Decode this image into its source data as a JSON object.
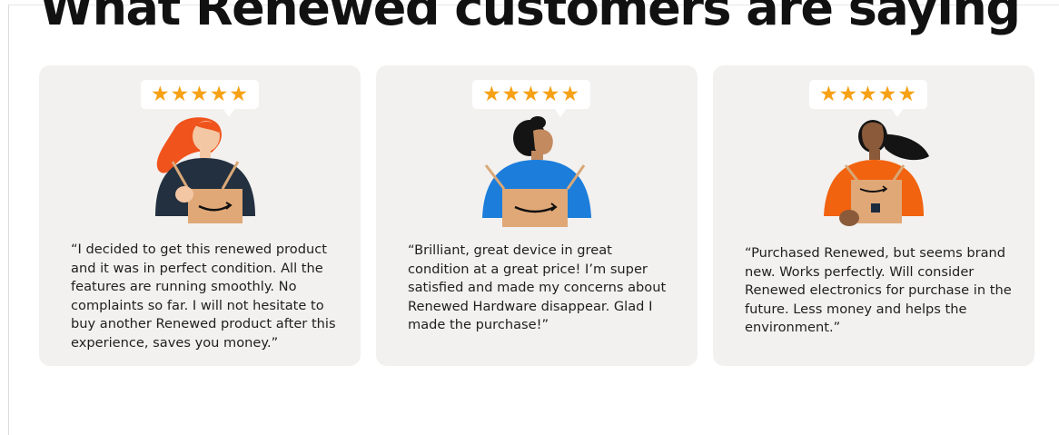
{
  "section": {
    "title": "What Renewed customers are saying"
  },
  "colors": {
    "card_background": "#f2f1ef",
    "star": "#f6a116",
    "box": "#e0a877"
  },
  "testimonials": [
    {
      "rating_stars": "★★★★★",
      "rating_value": 5,
      "illustration": "person-with-hair-holding-box-icon",
      "quote": "“I decided to get this renewed product and it was in perfect condition. All the features are running smoothly. No complaints so far. I will not hesitate to buy another Renewed product after this experience, saves you money.”"
    },
    {
      "rating_stars": "★★★★★",
      "rating_value": 5,
      "illustration": "person-in-blue-holding-box-icon",
      "quote": "“Brilliant, great device in great condition at a great price! I’m super satisfied and made my concerns about Renewed Hardware disappear. Glad I made the purchase!”"
    },
    {
      "rating_stars": "★★★★★",
      "rating_value": 5,
      "illustration": "person-in-orange-holding-box-icon",
      "quote": "“Purchased Renewed, but seems brand new. Works perfectly. Will consider Renewed electronics for purchase in the future. Less money and helps the environment.”"
    }
  ]
}
